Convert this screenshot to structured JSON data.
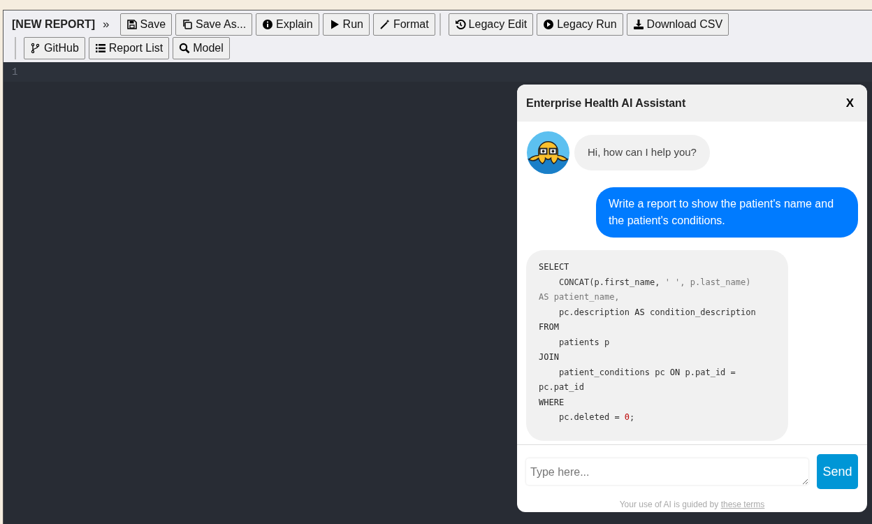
{
  "toolbar": {
    "title": "[NEW REPORT]",
    "chevron": "»",
    "groups": [
      [
        {
          "label": "Save"
        },
        {
          "label": "Save As..."
        },
        {
          "label": "Explain"
        },
        {
          "label": "Run"
        },
        {
          "label": "Format"
        }
      ],
      [
        {
          "label": "Legacy Edit"
        },
        {
          "label": "Legacy Run"
        },
        {
          "label": "Download CSV"
        }
      ],
      [
        {
          "label": "GitHub"
        },
        {
          "label": "Report List"
        },
        {
          "label": "Model"
        }
      ]
    ]
  },
  "editor": {
    "line_numbers": [
      "1"
    ]
  },
  "chat": {
    "title": "Enterprise Health AI Assistant",
    "close": "X",
    "messages": [
      {
        "kind": "bot-text",
        "text": "Hi, how can I help you?"
      },
      {
        "kind": "user-text",
        "text": "Write a report to show the patient's name and the patient's conditions."
      },
      {
        "kind": "bot-code",
        "lines": [
          [
            {
              "t": "SELECT",
              "kind": "keyword"
            }
          ],
          [
            {
              "t": "    CONCAT(p.first_name, ",
              "kind": "plain"
            },
            {
              "t": "' ', p.last_name)",
              "kind": "string"
            }
          ],
          [
            {
              "t": "AS patient_name,",
              "kind": "string"
            }
          ],
          [
            {
              "t": "    pc.description ",
              "kind": "plain"
            },
            {
              "t": "AS",
              "kind": "keyword"
            },
            {
              "t": " condition_description",
              "kind": "plain"
            }
          ],
          [
            {
              "t": "FROM",
              "kind": "keyword"
            }
          ],
          [
            {
              "t": "    patients p",
              "kind": "plain"
            }
          ],
          [
            {
              "t": "JOIN",
              "kind": "keyword"
            }
          ],
          [
            {
              "t": "    patient_conditions pc ",
              "kind": "plain"
            },
            {
              "t": "ON",
              "kind": "keyword"
            },
            {
              "t": " p.pat_id =",
              "kind": "plain"
            }
          ],
          [
            {
              "t": "pc.pat_id",
              "kind": "plain"
            }
          ],
          [
            {
              "t": "WHERE",
              "kind": "keyword"
            }
          ],
          [
            {
              "t": "    pc.deleted = ",
              "kind": "plain"
            },
            {
              "t": "0",
              "kind": "number"
            },
            {
              "t": ";",
              "kind": "plain"
            }
          ]
        ]
      }
    ],
    "input": {
      "placeholder": "Type here..."
    },
    "send": "Send",
    "footer": {
      "text": "Your use of AI is guided by",
      "link": "these terms"
    }
  }
}
